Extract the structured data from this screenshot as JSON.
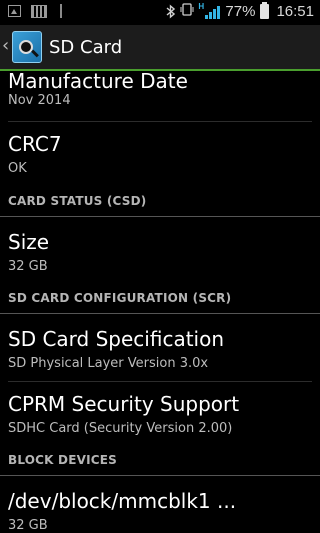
{
  "status_bar": {
    "battery_pct": "77%",
    "time": "16:51",
    "network_type": "H"
  },
  "action_bar": {
    "up_caret": "‹",
    "title": "SD Card",
    "accent_color": "#4a9e2e"
  },
  "items": [
    {
      "title": "Manufacture Date",
      "value": "Nov 2014"
    },
    {
      "title": "CRC7",
      "value": "OK"
    }
  ],
  "sections": [
    {
      "header": "CARD STATUS (CSD)",
      "items": [
        {
          "title": "Size",
          "value": "32 GB"
        }
      ]
    },
    {
      "header": "SD CARD CONFIGURATION (SCR)",
      "items": [
        {
          "title": "SD Card Specification",
          "value": "SD Physical Layer Version 3.0x"
        },
        {
          "title": "CPRM Security Support",
          "value": "SDHC Card (Security Version 2.00)"
        }
      ]
    },
    {
      "header": "BLOCK DEVICES",
      "items": [
        {
          "title": "/dev/block/mmcblk1 ...",
          "value": "32 GB"
        }
      ]
    }
  ]
}
